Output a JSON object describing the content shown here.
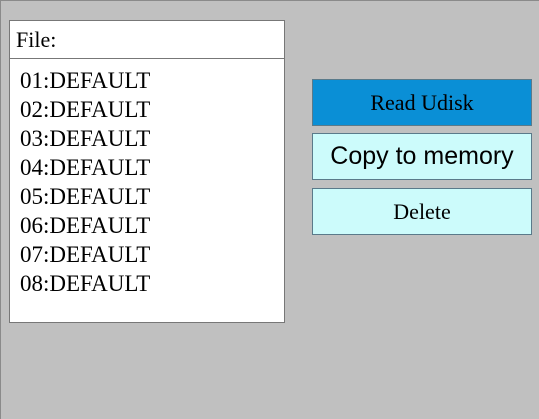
{
  "file_panel": {
    "header_label": "File:",
    "items": [
      "01:DEFAULT",
      "02:DEFAULT",
      "03:DEFAULT",
      "04:DEFAULT",
      "05:DEFAULT",
      "06:DEFAULT",
      "07:DEFAULT",
      "08:DEFAULT"
    ]
  },
  "actions": {
    "read_udisk_label": "Read Udisk",
    "copy_to_memory_label": "Copy to memory",
    "delete_label": "Delete"
  },
  "colors": {
    "background": "#c0c0c0",
    "read_button_active": "#0a8fd6",
    "button_default": "#ccfbfb",
    "list_background": "#ffffff"
  }
}
